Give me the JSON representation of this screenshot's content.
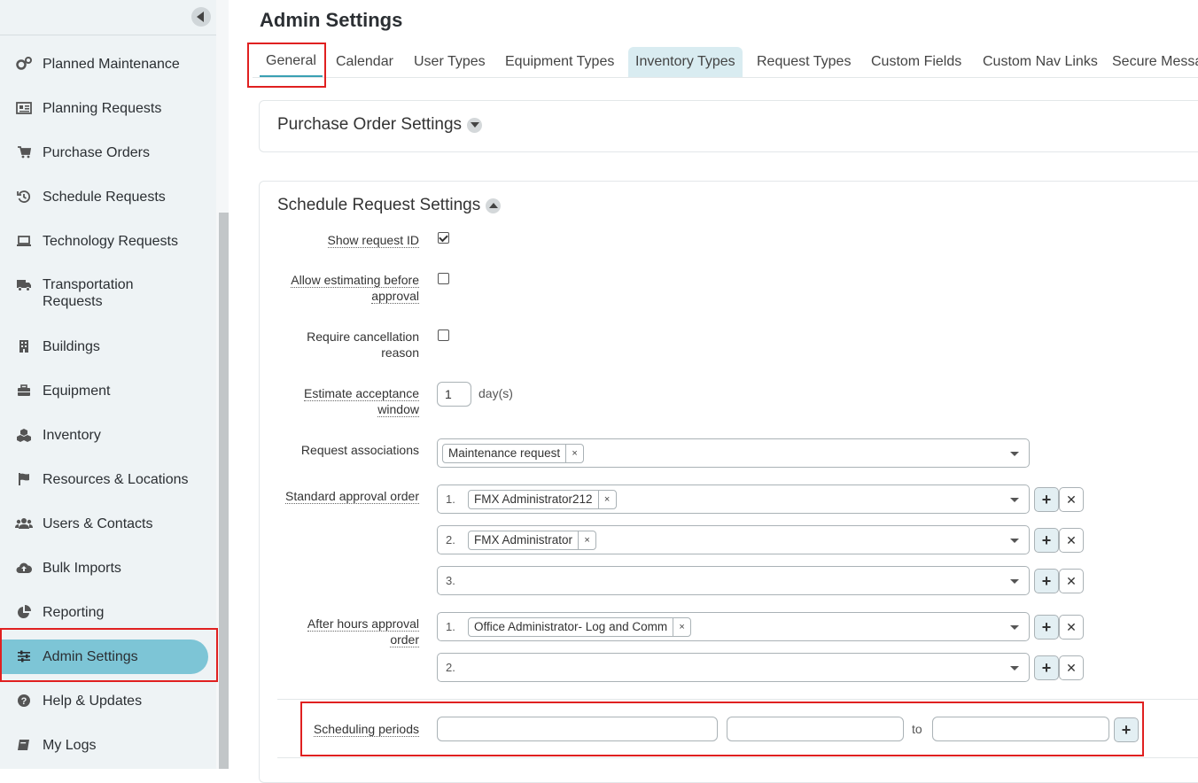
{
  "page_title": "Admin Settings",
  "sidebar": {
    "items": [
      {
        "label": "Planned Maintenance",
        "icon": "gears-icon"
      },
      {
        "label": "Planning Requests",
        "icon": "newspaper-icon"
      },
      {
        "label": "Purchase Orders",
        "icon": "cart-icon"
      },
      {
        "label": "Schedule Requests",
        "icon": "history-icon"
      },
      {
        "label": "Technology Requests",
        "icon": "laptop-icon"
      },
      {
        "label": "Transportation Requests",
        "icon": "truck-icon"
      },
      {
        "label": "Buildings",
        "icon": "building-icon"
      },
      {
        "label": "Equipment",
        "icon": "briefcase-icon"
      },
      {
        "label": "Inventory",
        "icon": "cubes-icon"
      },
      {
        "label": "Resources & Locations",
        "icon": "flag-icon"
      },
      {
        "label": "Users & Contacts",
        "icon": "users-icon"
      },
      {
        "label": "Bulk Imports",
        "icon": "cloud-upload-icon"
      },
      {
        "label": "Reporting",
        "icon": "pie-chart-icon"
      },
      {
        "label": "Admin Settings",
        "icon": "sliders-icon"
      },
      {
        "label": "Help & Updates",
        "icon": "question-circle-icon"
      },
      {
        "label": "My Logs",
        "icon": "book-icon"
      }
    ]
  },
  "tabs": [
    "General",
    "Calendar",
    "User Types",
    "Equipment Types",
    "Inventory Types",
    "Request Types",
    "Custom Fields",
    "Custom Nav Links",
    "Secure Messa"
  ],
  "purchase_order_panel": {
    "title": "Purchase Order Settings"
  },
  "schedule_panel": {
    "title": "Schedule Request Settings",
    "show_request_id": {
      "label": "Show request ID",
      "checked": true
    },
    "allow_estimating": {
      "label_line1": "Allow estimating before",
      "label_line2": "approval",
      "checked": false
    },
    "require_cancellation": {
      "label_line1": "Require cancellation",
      "label_line2": "reason",
      "checked": false
    },
    "estimate_window": {
      "label_line1": "Estimate acceptance",
      "label_line2": "window",
      "value": "1",
      "unit": "day(s)"
    },
    "request_associations": {
      "label": "Request associations",
      "chip": "Maintenance request"
    },
    "standard_approval": {
      "label": "Standard approval order",
      "rows": [
        {
          "num": "1.",
          "chip": "FMX Administrator212"
        },
        {
          "num": "2.",
          "chip": "FMX Administrator"
        },
        {
          "num": "3.",
          "chip": ""
        }
      ]
    },
    "after_hours": {
      "label_line1": "After hours approval",
      "label_line2": "order",
      "rows": [
        {
          "num": "1.",
          "chip": "Office Administrator- Log and Comm"
        },
        {
          "num": "2.",
          "chip": ""
        }
      ]
    },
    "scheduling_periods": {
      "label": "Scheduling periods",
      "to": "to"
    }
  },
  "buttons": {
    "plus": "+",
    "remove": "✕",
    "chip_remove": "×"
  }
}
